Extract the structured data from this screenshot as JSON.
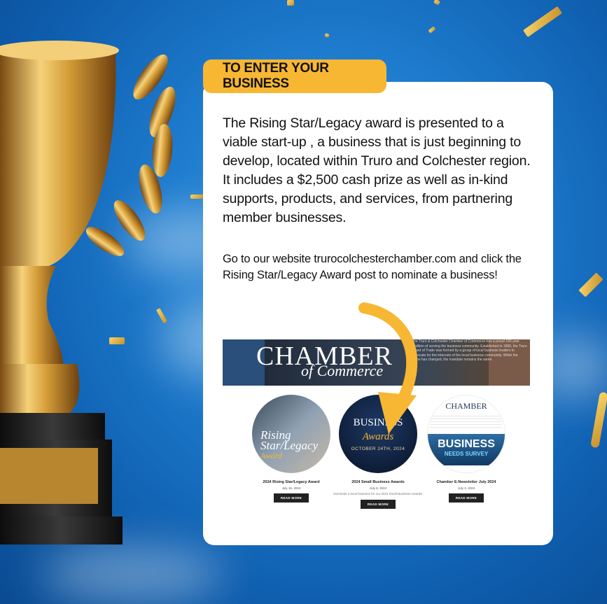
{
  "header": {
    "title": "TO ENTER YOUR BUSINESS"
  },
  "card": {
    "paragraph1": "The Rising Star/Legacy award is presented to a viable start-up , a business that is just beginning to develop, located within Truro and Colchester region. It includes a $2,500 cash prize as well as in-kind supports, products, and services, from partnering member businesses.",
    "paragraph2": "Go to our website trurocolchesterchamber.com and click the Rising Star/Legacy Award post to nominate a business!"
  },
  "screenshot": {
    "banner": {
      "title": "CHAMBER",
      "subtitle": "of Commerce",
      "text": "The Truro & Colchester Chamber of Commerce has a proud 180-year tradition of serving the business community. Established in 1890, the Truro Board of Trade was formed by a group of local business leaders to advocate for the interests of the local business community. While the name has changed, the mandate remains the same."
    },
    "posts": [
      {
        "image_text_1": "Rising",
        "image_text_2": "Star/Legacy",
        "image_text_3": "Award",
        "title": "2024 Rising Star/Legacy Award",
        "date": "July 15, 2024",
        "description": "",
        "button": "READ MORE"
      },
      {
        "image_text_1": "BUSINESS",
        "image_text_2": "Awards",
        "image_text_3": "OCTOBER 24TH, 2024",
        "title": "2024 Small Business Awards",
        "date": "July 8, 2024",
        "description": "Nominate a local business for our 2024 Small Business Awards!",
        "button": "READ MORE"
      },
      {
        "image_text_1": "CHAMBER",
        "image_text_2": "BUSINESS",
        "image_text_3": "NEEDS SURVEY",
        "title": "Chamber E-Newsletter July 2024",
        "date": "July 3, 2024",
        "description": "",
        "button": "READ MORE"
      }
    ]
  },
  "colors": {
    "accent": "#f7b733",
    "background": "#1f7dcf",
    "card": "#ffffff"
  }
}
